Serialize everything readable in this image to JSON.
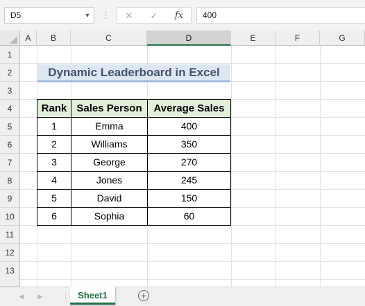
{
  "formula_bar": {
    "name_box": "D5",
    "name_box_arrow": "▼",
    "separator": "⋮",
    "cancel_icon": "✕",
    "enter_icon": "✓",
    "fx_label": "fx",
    "formula_value": "400"
  },
  "columns": [
    "A",
    "B",
    "C",
    "D",
    "E",
    "F",
    "G"
  ],
  "rows": [
    "1",
    "2",
    "3",
    "4",
    "5",
    "6",
    "7",
    "8",
    "9",
    "10",
    "11",
    "12",
    "13"
  ],
  "selected_cell": "D5",
  "title": "Dynamic Leaderboard in Excel",
  "table": {
    "headers": [
      "Rank",
      "Sales Person",
      "Average Sales"
    ],
    "rows": [
      [
        "1",
        "Emma",
        "400"
      ],
      [
        "2",
        "Williams",
        "350"
      ],
      [
        "3",
        "George",
        "270"
      ],
      [
        "4",
        "Jones",
        "245"
      ],
      [
        "5",
        "David",
        "150"
      ],
      [
        "6",
        "Sophia",
        "60"
      ]
    ]
  },
  "sheet_tabs": {
    "prev_arrow": "◀",
    "next_arrow": "▶",
    "separator": "⋮",
    "active_tab": "Sheet1",
    "add_sheet": "+"
  },
  "colors": {
    "accent": "#217346",
    "title_fill": "#dde6f2",
    "title_text": "#44546a",
    "header_fill": "#e2efda"
  }
}
